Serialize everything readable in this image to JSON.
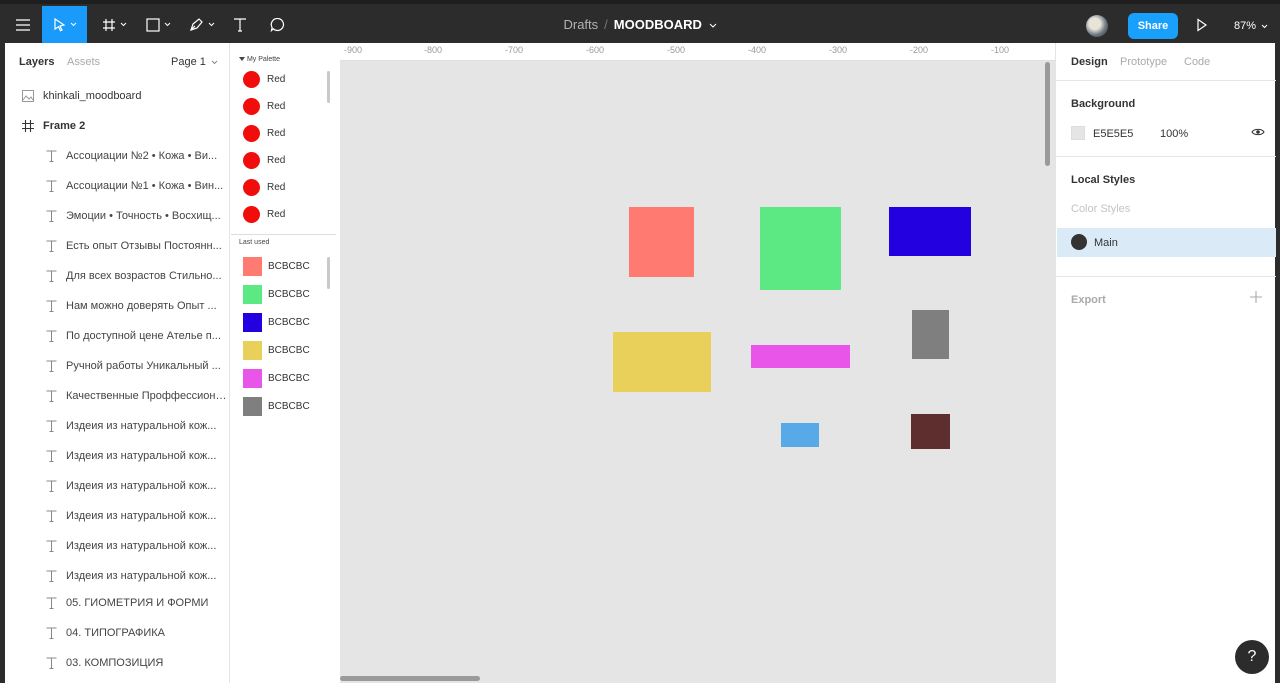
{
  "toolbar": {
    "breadcrumb_parent": "Drafts",
    "breadcrumb_sep": "/",
    "file_name": "MOODBOARD",
    "share_label": "Share",
    "zoom": "87%"
  },
  "layers_panel": {
    "tab_layers": "Layers",
    "tab_assets": "Assets",
    "page": "Page 1",
    "page_name": "khinkali_moodboard",
    "frame_name": "Frame 2",
    "items": [
      "Ассоциации №2 • Кожа • Ви...",
      "Ассоциации №1 • Кожа • Вин...",
      "Эмоции • Точность • Восхищ...",
      "Есть опыт Отзывы Постоянн...",
      "Для всех возрастов Стильно...",
      "Нам можно доверять Опыт ...",
      "По доступной цене Ателье п...",
      "Ручной работы Уникальный ...",
      "Качественные Проффессиона...",
      "Издеия из натуральной кож...",
      "Издеия из натуральной кож...",
      "Издеия из натуральной кож...",
      "Издеия из натуральной кож...",
      "Издеия из натуральной кож...",
      "Издеия из натуральной кож...",
      "05. ГИОМЕТРИЯ И ФОРМИ",
      "04. ТИПОГРАФИКА",
      "03. КОМПОЗИЦИЯ"
    ]
  },
  "palette_panel": {
    "my_palette_label": "My Palette",
    "palette_items": [
      {
        "label": "Red",
        "color": "#f20d0d"
      },
      {
        "label": "Red",
        "color": "#f20d0d"
      },
      {
        "label": "Red",
        "color": "#f20d0d"
      },
      {
        "label": "Red",
        "color": "#f20d0d"
      },
      {
        "label": "Red",
        "color": "#f20d0d"
      },
      {
        "label": "Red",
        "color": "#f20d0d"
      }
    ],
    "last_used_label": "Last used",
    "last_used": [
      {
        "label": "BCBCBC",
        "color": "#ff7a70"
      },
      {
        "label": "BCBCBC",
        "color": "#5ce882"
      },
      {
        "label": "BCBCBC",
        "color": "#2200e0"
      },
      {
        "label": "BCBCBC",
        "color": "#e8d05a"
      },
      {
        "label": "BCBCBC",
        "color": "#e855e8"
      },
      {
        "label": "BCBCBC",
        "color": "#7f7f7f"
      }
    ]
  },
  "canvas": {
    "background": "#e5e5e5",
    "ruler": [
      "-900",
      "-800",
      "-700",
      "-600",
      "-500",
      "-400",
      "-300",
      "-200",
      "-100"
    ],
    "shape_colors": {
      "coral": "#ff7a70",
      "green": "#5ce882",
      "blue": "#2200e0",
      "yellow": "#e8d05a",
      "magenta": "#e855e8",
      "gray": "#7f7f7f",
      "light_blue": "#58a9e8",
      "brown": "#5e2e2e"
    }
  },
  "design_panel": {
    "tab_design": "Design",
    "tab_prototype": "Prototype",
    "tab_code": "Code",
    "background_heading": "Background",
    "background_hex": "E5E5E5",
    "background_opacity": "100%",
    "local_styles_heading": "Local Styles",
    "color_styles_label": "Color Styles",
    "style_name": "Main",
    "export_label": "Export"
  },
  "help_label": "?"
}
